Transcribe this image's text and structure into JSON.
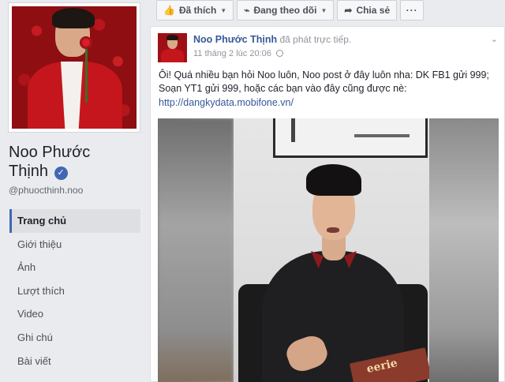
{
  "page": {
    "name": "Noo Phước Thịnh",
    "name_line1": "Noo Phước",
    "name_line2": "Thịnh",
    "handle": "@phuocthinh.noo",
    "verified": true
  },
  "nav": {
    "items": [
      {
        "label": "Trang chủ",
        "active": true
      },
      {
        "label": "Giới thiệu"
      },
      {
        "label": "Ảnh"
      },
      {
        "label": "Lượt thích"
      },
      {
        "label": "Video"
      },
      {
        "label": "Ghi chú"
      },
      {
        "label": "Bài viết"
      }
    ]
  },
  "actions": {
    "like_label": "Đã thích",
    "follow_label": "Đang theo dõi",
    "share_label": "Chia sẻ",
    "more_label": "···"
  },
  "post": {
    "author": "Noo Phước Thịnh",
    "action_text": "đã phát trực tiếp.",
    "timestamp": "11 tháng 2 lúc 20:06",
    "text": "Ôi! Quá nhiều bạn hỏi Noo luôn, Noo post ở đây luôn nha: DK FB1 gửi 999; Soạn YT1 gửi 999, hoặc các bạn vào đây cũng được nè:",
    "link": "http://dangkydata.mobifone.vn/"
  },
  "video": {
    "book_text": "eerie"
  },
  "colors": {
    "accent": "#4267b2",
    "link": "#365899",
    "background": "#e9ebee"
  }
}
